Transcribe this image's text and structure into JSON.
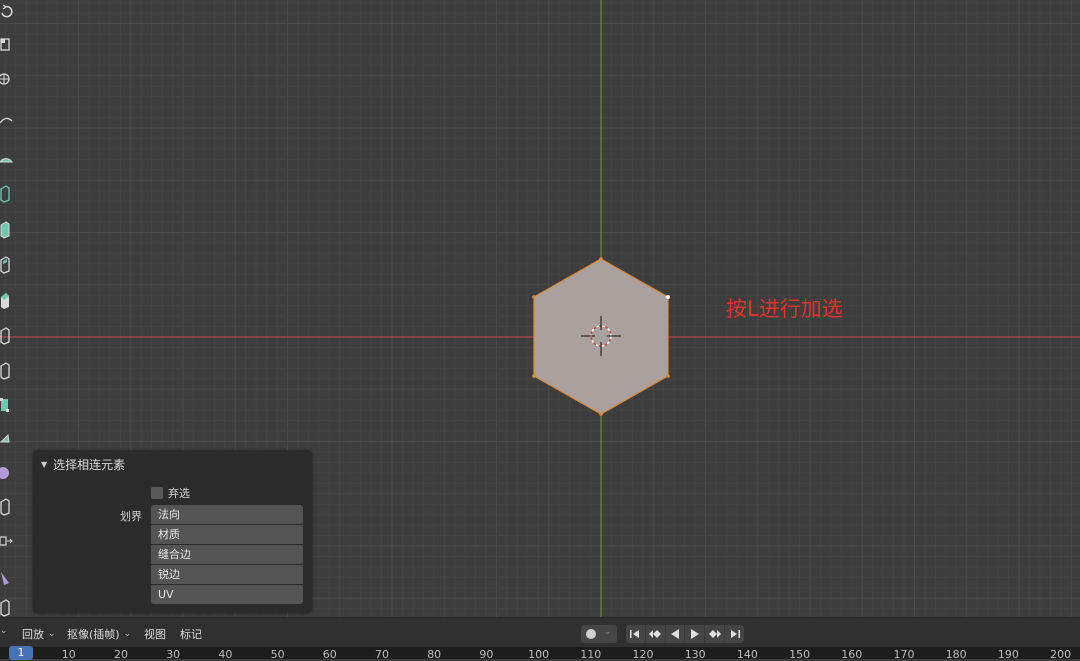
{
  "annotation": {
    "text": "按L进行加选",
    "color": "#e8322a"
  },
  "redo_panel": {
    "title": "选择相连元素",
    "deselect_label": "弃选",
    "delimit_label": "划界",
    "delimit_options": [
      "法向",
      "材质",
      "缝合边",
      "锐边",
      "UV"
    ]
  },
  "timeline": {
    "playback_menu": "回放",
    "keying_menu": "抠像(插帧)",
    "view_menu": "视图",
    "marker_menu": "标记",
    "current_frame": "1",
    "ruler_ticks": [
      "10",
      "20",
      "30",
      "40",
      "50",
      "60",
      "70",
      "80",
      "90",
      "100",
      "110",
      "120",
      "130",
      "140",
      "150",
      "160",
      "170",
      "180",
      "190",
      "200"
    ]
  },
  "colors": {
    "viewport_bg": "#3d3d3d",
    "x_axis": "#c94a4a",
    "y_axis": "#6d9c38",
    "mesh_face": "#aaa19e",
    "mesh_edge": "#e08a3c",
    "current_frame_bg": "#4772b3"
  },
  "icons": {
    "toolbar": [
      "rotate-icon",
      "scale-icon",
      "transform-icon",
      "annotate-icon",
      "measure-icon",
      "add-cube-icon",
      "extrude-icon",
      "inset-icon",
      "bevel-icon",
      "loop-cut-icon",
      "knife-icon",
      "poly-build-icon",
      "spin-icon",
      "smooth-icon",
      "edge-slide-icon",
      "shrink-fatten-icon",
      "shear-icon",
      "rip-icon"
    ],
    "playback": [
      "jump-start-icon",
      "prev-keyframe-icon",
      "play-reverse-icon",
      "play-icon",
      "next-keyframe-icon",
      "jump-end-icon"
    ]
  }
}
